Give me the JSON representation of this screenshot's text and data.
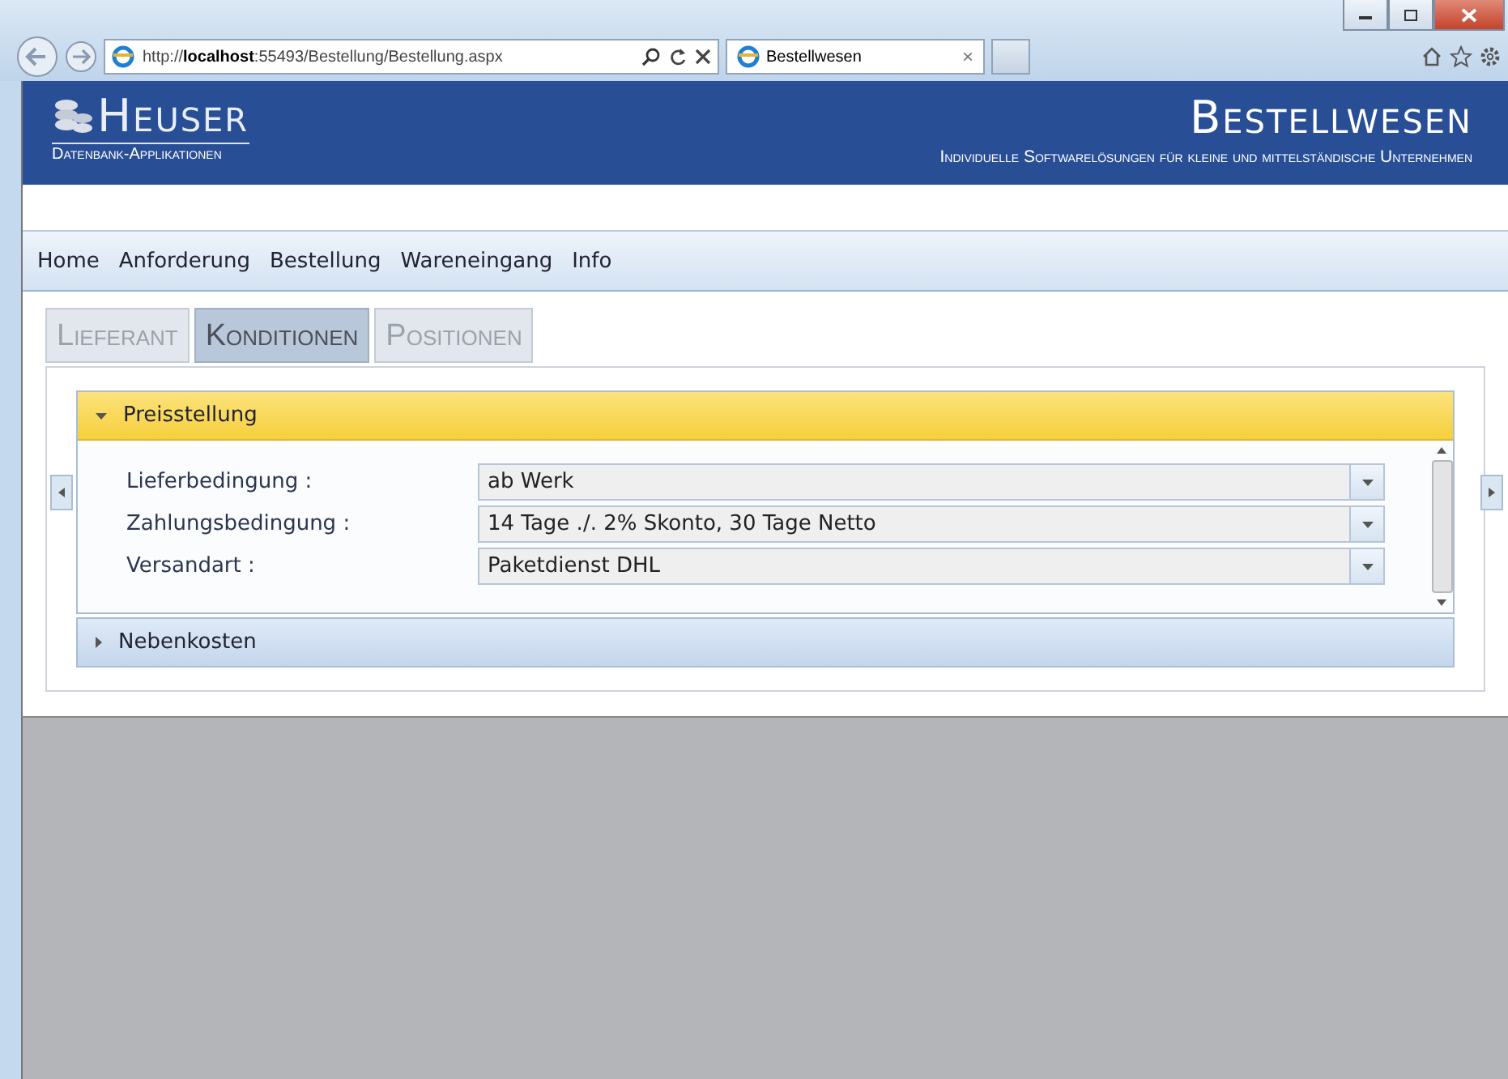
{
  "browser": {
    "address": "http://**localhost**:55493/Bestellung/Bestellung.aspx",
    "tab": {
      "title": "Bestellwesen",
      "close": "×"
    }
  },
  "header": {
    "logo": "Heuser",
    "logo_sub": "Datenbank-Applikationen",
    "title": "Bestellwesen",
    "subtitle": "Individuelle Softwarelösungen für kleine und mittelständische Unternehmen"
  },
  "nav": [
    "Home",
    "Anforderung",
    "Bestellung",
    "Wareneingang",
    "Info"
  ],
  "tabs": [
    {
      "label": "Lieferant",
      "selected": false
    },
    {
      "label": "Konditionen",
      "selected": true
    },
    {
      "label": "Positionen",
      "selected": false
    }
  ],
  "sections": [
    {
      "title": "Preisstellung",
      "expanded": true,
      "fields": [
        {
          "label": "Lieferbedingung :",
          "value": "ab Werk"
        },
        {
          "label": "Zahlungsbedingung :",
          "value": "14 Tage ./. 2% Skonto, 30 Tage Netto"
        },
        {
          "label": "Versandart :",
          "value": "Paketdienst DHL"
        }
      ]
    },
    {
      "title": "Nebenkosten",
      "expanded": false
    }
  ]
}
